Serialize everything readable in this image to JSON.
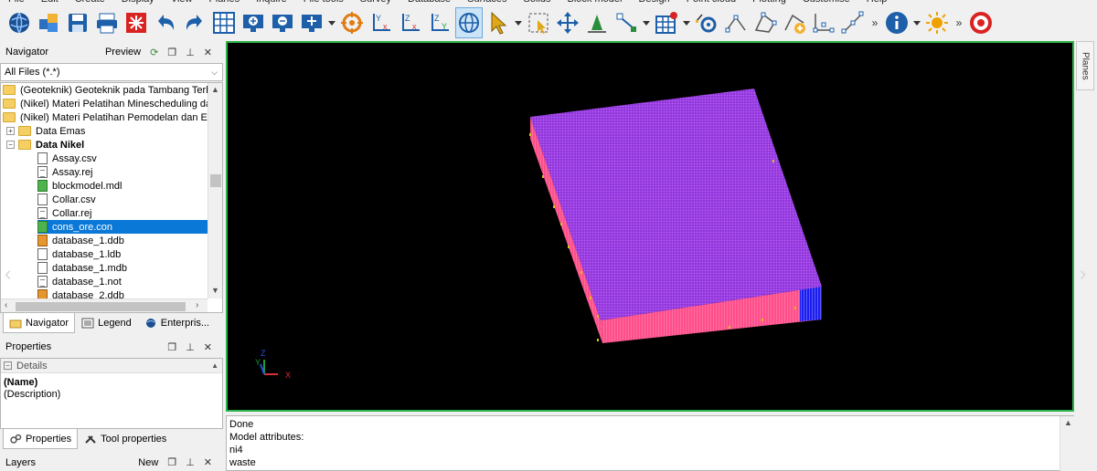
{
  "menu": {
    "items": [
      "File",
      "Edit",
      "Create",
      "Display",
      "View",
      "Planes",
      "Inquire",
      "File tools",
      "Survey",
      "Database",
      "Surfaces",
      "Solids",
      "Block model",
      "Design",
      "Point cloud",
      "Plotting",
      "Customise",
      "Help"
    ]
  },
  "toolbar": {
    "overflow_label": "»",
    "buttons": [
      {
        "name": "globe",
        "color": "#1b4f8f"
      },
      {
        "name": "cubes",
        "color": "#2c6fbe"
      },
      {
        "name": "save",
        "color": "#1d5fa8"
      },
      {
        "name": "print",
        "color": "#1d5fa8"
      },
      {
        "name": "reset-view",
        "color": "#d92323"
      },
      {
        "name": "undo",
        "color": "#1d5fa8"
      },
      {
        "name": "redo",
        "color": "#1d5fa8"
      },
      {
        "name": "grid-view",
        "color": "#1d5fa8"
      },
      {
        "name": "zoom-in",
        "color": "#1d5fa8"
      },
      {
        "name": "zoom-out",
        "color": "#1d5fa8"
      },
      {
        "name": "zoom-extents",
        "color": "#1d5fa8"
      },
      {
        "name": "target",
        "color": "#e07b12"
      },
      {
        "name": "axis-yx",
        "color": "#1d5fa8"
      },
      {
        "name": "axis-zx",
        "color": "#1d5fa8"
      },
      {
        "name": "axis-zy",
        "color": "#1d5fa8"
      },
      {
        "name": "rotate",
        "color": "#1d5fa8"
      },
      {
        "name": "select-pointer",
        "color": "#e0a818"
      },
      {
        "name": "select-box",
        "color": "#e0a818"
      },
      {
        "name": "pan",
        "color": "#1d5fa8"
      },
      {
        "name": "digitise",
        "color": "#2a8c3c"
      },
      {
        "name": "string-select",
        "color": "#1d5fa8"
      },
      {
        "name": "grid-red",
        "color": "#1d5fa8"
      },
      {
        "name": "settings-points",
        "color": "#1d5fa8"
      },
      {
        "name": "measure",
        "color": "#1d5fa8"
      },
      {
        "name": "polygon",
        "color": "#1d5fa8"
      },
      {
        "name": "add-point",
        "color": "#1d5fa8"
      },
      {
        "name": "line-shape",
        "color": "#1d5fa8"
      },
      {
        "name": "line-diagonal",
        "color": "#1d5fa8"
      },
      {
        "name": "info",
        "color": "#1d5fa8"
      },
      {
        "name": "sun",
        "color": "#f0a100"
      },
      {
        "name": "stop-target",
        "color": "#d92323"
      }
    ]
  },
  "navigator": {
    "title": "Navigator",
    "preview_label": "Preview",
    "filter_value": "All Files (*.*)",
    "items": [
      {
        "label": "(Geoteknik) Geoteknik pada Tambang Terbuka",
        "type": "folder",
        "indent": 0,
        "expander": ""
      },
      {
        "label": "(Nikel) Materi Pelatihan Minescheduling dan M",
        "type": "folder",
        "indent": 0,
        "expander": ""
      },
      {
        "label": "(Nikel) Materi Pelatihan Pemodelan dan Estima",
        "type": "folder",
        "indent": 0,
        "expander": ""
      },
      {
        "label": "Data Emas",
        "type": "folder",
        "indent": 1,
        "expander": "+"
      },
      {
        "label": "Data Nikel",
        "type": "folder-check",
        "indent": 1,
        "expander": "−",
        "bold": true
      },
      {
        "label": "Assay.csv",
        "type": "file",
        "indent": 2
      },
      {
        "label": "Assay.rej",
        "type": "file-lines",
        "indent": 2
      },
      {
        "label": "blockmodel.mdl",
        "type": "file-green",
        "indent": 2
      },
      {
        "label": "Collar.csv",
        "type": "file",
        "indent": 2
      },
      {
        "label": "Collar.rej",
        "type": "file-lines",
        "indent": 2
      },
      {
        "label": "cons_ore.con",
        "type": "file-green",
        "indent": 2,
        "selected": true
      },
      {
        "label": "database_1.ddb",
        "type": "file-orange",
        "indent": 2
      },
      {
        "label": "database_1.ldb",
        "type": "file",
        "indent": 2
      },
      {
        "label": "database_1.mdb",
        "type": "file",
        "indent": 2
      },
      {
        "label": "database_1.not",
        "type": "file-lines",
        "indent": 2
      },
      {
        "label": "database_2.ddb",
        "type": "file-orange",
        "indent": 2
      }
    ],
    "tabs": [
      {
        "label": "Navigator",
        "active": true
      },
      {
        "label": "Legend",
        "active": false
      },
      {
        "label": "Enterpris...",
        "active": false
      }
    ]
  },
  "properties": {
    "title": "Properties",
    "category": "Details",
    "name_label": "(Name)",
    "description_label": "(Description)",
    "tabs": [
      {
        "label": "Properties",
        "active": true
      },
      {
        "label": "Tool properties",
        "active": false
      }
    ]
  },
  "layers": {
    "title": "Layers",
    "new_label": "New"
  },
  "viewport": {
    "background": "#000000",
    "border_color": "#2bb34a",
    "top_face_color": "#9b3fe3",
    "front_face_color": "#ff4f8b",
    "right_face_color": "#1a1cf0",
    "axis_labels": {
      "x": "X",
      "y": "Y",
      "z": "Z"
    }
  },
  "side": {
    "planes_label": "Planes",
    "left_arrow": "‹",
    "right_arrow": "›"
  },
  "output": {
    "lines": [
      "Done",
      "Model attributes:",
      "ni4",
      "waste"
    ]
  }
}
